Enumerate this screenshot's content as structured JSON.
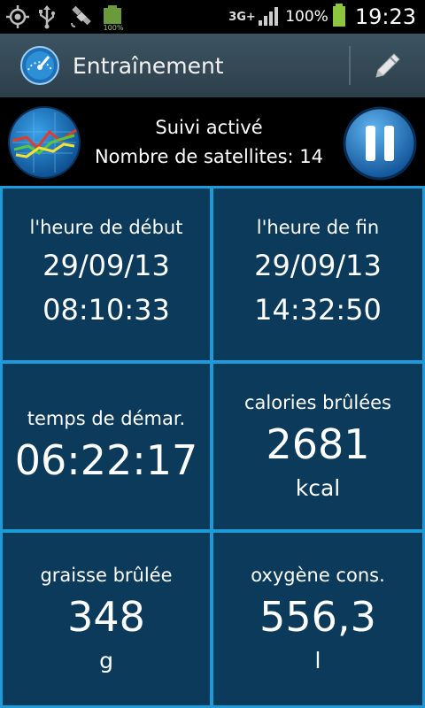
{
  "status_bar": {
    "network": "3G+",
    "battery_small": "100%",
    "battery_percent": "100%",
    "time": "19:23",
    "icons": [
      "gps-icon",
      "usb-icon",
      "satellite-icon",
      "battery-icon",
      "signal-icon"
    ]
  },
  "action_bar": {
    "title": "Entraînement",
    "icons": [
      "speedometer-icon",
      "pencil-icon"
    ]
  },
  "tracking": {
    "status": "Suivi activé",
    "satellites": "Nombre de satellites: 14"
  },
  "stats": {
    "start": {
      "label": "l'heure de début",
      "date": "29/09/13",
      "time": "08:10:33"
    },
    "end": {
      "label": "l'heure de fin",
      "date": "29/09/13",
      "time": "14:32:50"
    },
    "duration": {
      "label": "temps de démar.",
      "value": "06:22:17"
    },
    "calories": {
      "label": "calories brûlées",
      "value": "2681",
      "unit": "kcal"
    },
    "fat": {
      "label": "graisse brûlée",
      "value": "348",
      "unit": "g"
    },
    "oxygen": {
      "label": "oxygène cons.",
      "value": "556,3",
      "unit": "l"
    }
  },
  "colors": {
    "tile_bg": "#0b3a5a",
    "grid_line": "#1e9ad8",
    "action_bar": "#34495a",
    "battery": "#8ec63f"
  }
}
